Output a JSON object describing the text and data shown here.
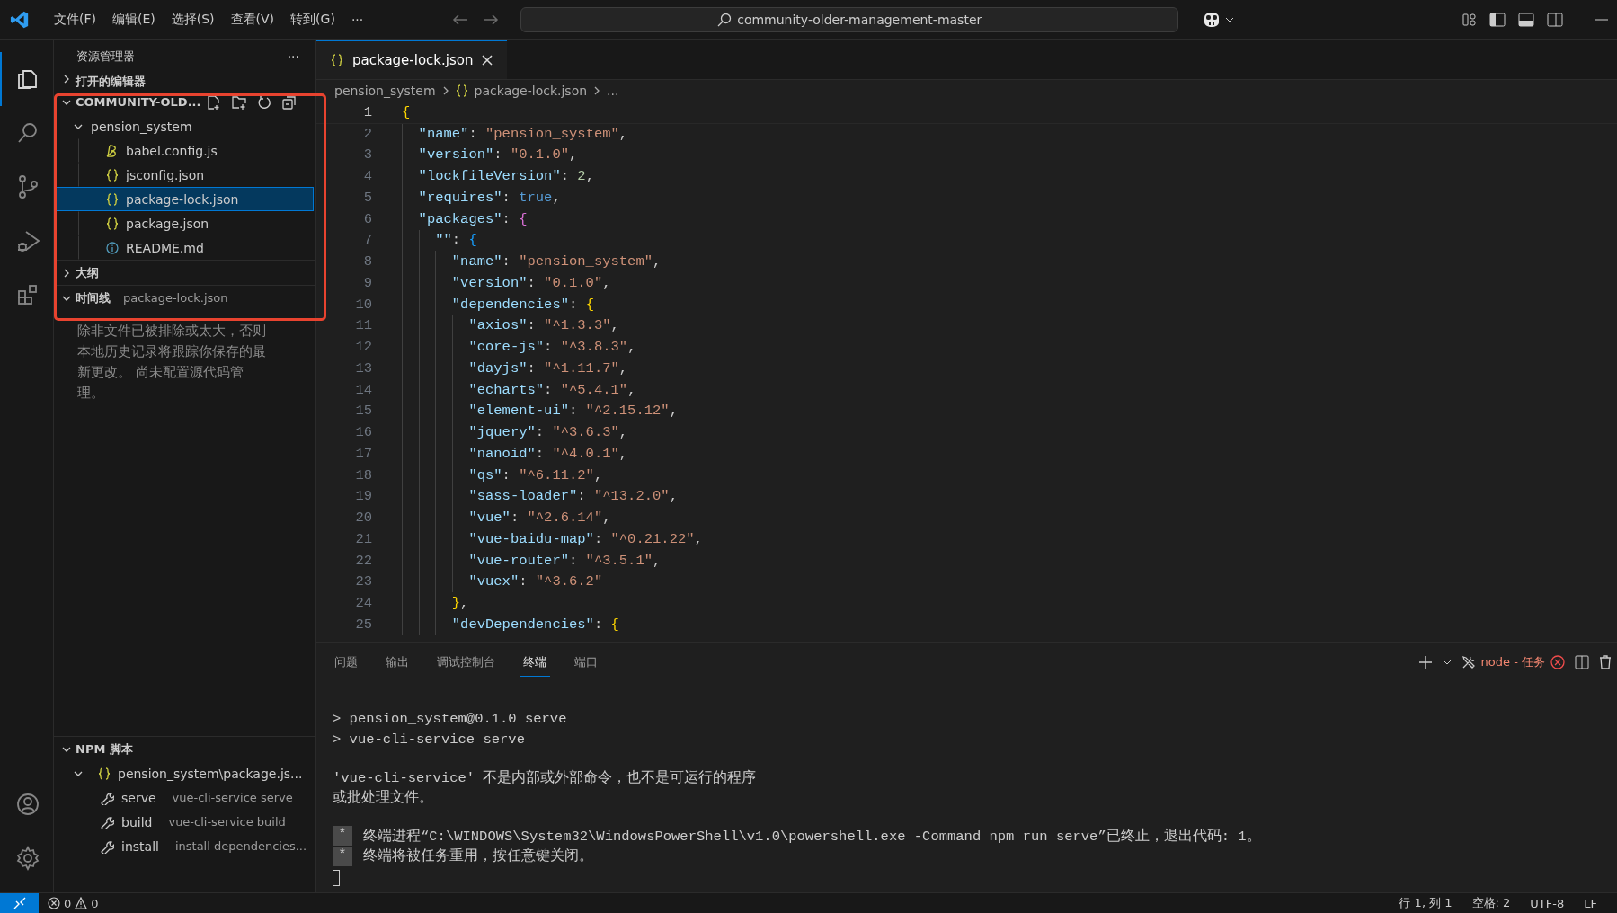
{
  "title_bar": {
    "menus": [
      "文件(F)",
      "编辑(E)",
      "选择(S)",
      "查看(V)",
      "转到(G)",
      "···"
    ],
    "search": "community-older-management-master"
  },
  "activity_bar": [
    {
      "kind": "explorer",
      "selected": true
    },
    {
      "kind": "search",
      "selected": false
    },
    {
      "kind": "source-control",
      "selected": false
    },
    {
      "kind": "run-debug",
      "selected": false
    },
    {
      "kind": "extensions",
      "selected": false
    },
    {
      "kind": "account",
      "selected": false
    },
    {
      "kind": "settings",
      "selected": false
    }
  ],
  "sidebar": {
    "title": "资源管理器",
    "more": "···",
    "open_editors": {
      "label": "打开的编辑器",
      "expanded": false
    },
    "folder": {
      "label": "COMMUNITY-OLD...",
      "expanded": true,
      "children": [
        {
          "label": "pension_system",
          "expanded": true,
          "children": [
            {
              "label": "babel.config.js",
              "kind": "babel",
              "selected": false
            },
            {
              "label": "jsconfig.json",
              "kind": "json",
              "selected": false
            },
            {
              "label": "package-lock.json",
              "kind": "json",
              "selected": true
            },
            {
              "label": "package.json",
              "kind": "json",
              "selected": false
            },
            {
              "label": "README.md",
              "kind": "info",
              "selected": false
            }
          ]
        }
      ]
    },
    "outline": {
      "label": "大纲",
      "expanded": false
    },
    "timeline": {
      "label": "时间线",
      "description": "package-lock.json",
      "expanded": true,
      "message": "除非文件已被排除或太大，否则本地历史记录将跟踪你保存的最新更改。 尚未配置源代码管理。"
    },
    "npm": {
      "label": "NPM 脚本",
      "expanded": true,
      "children": [
        {
          "label": "pension_system\\package.js...",
          "expanded": true,
          "children": [
            {
              "label": "serve",
              "description": "vue-cli-service serve"
            },
            {
              "label": "build",
              "description": "vue-cli-service build"
            },
            {
              "label": "install",
              "description": "install dependencies..."
            }
          ]
        }
      ]
    }
  },
  "tabs": [
    {
      "label": "package-lock.json",
      "selected": true
    }
  ],
  "breadcrumb": [
    "pension_system",
    "package-lock.json",
    "..."
  ],
  "editor": {
    "lines": [
      {
        "number": "1",
        "tokens": [
          {
            "kind": "brace1",
            "text": "{"
          }
        ]
      },
      {
        "number": "2",
        "tokens": [
          {
            "kind": "key",
            "text": "  \"name\""
          },
          {
            "kind": "punct",
            "text": ": "
          },
          {
            "kind": "string",
            "text": "\"pension_system\""
          },
          {
            "kind": "punct",
            "text": ","
          }
        ]
      },
      {
        "number": "3",
        "tokens": [
          {
            "kind": "key",
            "text": "  \"version\""
          },
          {
            "kind": "punct",
            "text": ": "
          },
          {
            "kind": "string",
            "text": "\"0.1.0\""
          },
          {
            "kind": "punct",
            "text": ","
          }
        ]
      },
      {
        "number": "4",
        "tokens": [
          {
            "kind": "key",
            "text": "  \"lockfileVersion\""
          },
          {
            "kind": "punct",
            "text": ": "
          },
          {
            "kind": "number",
            "text": "2"
          },
          {
            "kind": "punct",
            "text": ","
          }
        ]
      },
      {
        "number": "5",
        "tokens": [
          {
            "kind": "key",
            "text": "  \"requires\""
          },
          {
            "kind": "punct",
            "text": ": "
          },
          {
            "kind": "bool",
            "text": "true"
          },
          {
            "kind": "punct",
            "text": ","
          }
        ]
      },
      {
        "number": "6",
        "tokens": [
          {
            "kind": "key",
            "text": "  \"packages\""
          },
          {
            "kind": "punct",
            "text": ": "
          },
          {
            "kind": "brace2",
            "text": "{"
          }
        ]
      },
      {
        "number": "7",
        "tokens": [
          {
            "kind": "key",
            "text": "    \"\""
          },
          {
            "kind": "punct",
            "text": ": "
          },
          {
            "kind": "brace3",
            "text": "{"
          }
        ]
      },
      {
        "number": "8",
        "tokens": [
          {
            "kind": "key",
            "text": "      \"name\""
          },
          {
            "kind": "punct",
            "text": ": "
          },
          {
            "kind": "string",
            "text": "\"pension_system\""
          },
          {
            "kind": "punct",
            "text": ","
          }
        ]
      },
      {
        "number": "9",
        "tokens": [
          {
            "kind": "key",
            "text": "      \"version\""
          },
          {
            "kind": "punct",
            "text": ": "
          },
          {
            "kind": "string",
            "text": "\"0.1.0\""
          },
          {
            "kind": "punct",
            "text": ","
          }
        ]
      },
      {
        "number": "10",
        "tokens": [
          {
            "kind": "key",
            "text": "      \"dependencies\""
          },
          {
            "kind": "punct",
            "text": ": "
          },
          {
            "kind": "brace1",
            "text": "{"
          }
        ]
      },
      {
        "number": "11",
        "tokens": [
          {
            "kind": "key",
            "text": "        \"axios\""
          },
          {
            "kind": "punct",
            "text": ": "
          },
          {
            "kind": "string",
            "text": "\"^1.3.3\""
          },
          {
            "kind": "punct",
            "text": ","
          }
        ]
      },
      {
        "number": "12",
        "tokens": [
          {
            "kind": "key",
            "text": "        \"core-js\""
          },
          {
            "kind": "punct",
            "text": ": "
          },
          {
            "kind": "string",
            "text": "\"^3.8.3\""
          },
          {
            "kind": "punct",
            "text": ","
          }
        ]
      },
      {
        "number": "13",
        "tokens": [
          {
            "kind": "key",
            "text": "        \"dayjs\""
          },
          {
            "kind": "punct",
            "text": ": "
          },
          {
            "kind": "string",
            "text": "\"^1.11.7\""
          },
          {
            "kind": "punct",
            "text": ","
          }
        ]
      },
      {
        "number": "14",
        "tokens": [
          {
            "kind": "key",
            "text": "        \"echarts\""
          },
          {
            "kind": "punct",
            "text": ": "
          },
          {
            "kind": "string",
            "text": "\"^5.4.1\""
          },
          {
            "kind": "punct",
            "text": ","
          }
        ]
      },
      {
        "number": "15",
        "tokens": [
          {
            "kind": "key",
            "text": "        \"element-ui\""
          },
          {
            "kind": "punct",
            "text": ": "
          },
          {
            "kind": "string",
            "text": "\"^2.15.12\""
          },
          {
            "kind": "punct",
            "text": ","
          }
        ]
      },
      {
        "number": "16",
        "tokens": [
          {
            "kind": "key",
            "text": "        \"jquery\""
          },
          {
            "kind": "punct",
            "text": ": "
          },
          {
            "kind": "string",
            "text": "\"^3.6.3\""
          },
          {
            "kind": "punct",
            "text": ","
          }
        ]
      },
      {
        "number": "17",
        "tokens": [
          {
            "kind": "key",
            "text": "        \"nanoid\""
          },
          {
            "kind": "punct",
            "text": ": "
          },
          {
            "kind": "string",
            "text": "\"^4.0.1\""
          },
          {
            "kind": "punct",
            "text": ","
          }
        ]
      },
      {
        "number": "18",
        "tokens": [
          {
            "kind": "key",
            "text": "        \"qs\""
          },
          {
            "kind": "punct",
            "text": ": "
          },
          {
            "kind": "string",
            "text": "\"^6.11.2\""
          },
          {
            "kind": "punct",
            "text": ","
          }
        ]
      },
      {
        "number": "19",
        "tokens": [
          {
            "kind": "key",
            "text": "        \"sass-loader\""
          },
          {
            "kind": "punct",
            "text": ": "
          },
          {
            "kind": "string",
            "text": "\"^13.2.0\""
          },
          {
            "kind": "punct",
            "text": ","
          }
        ]
      },
      {
        "number": "20",
        "tokens": [
          {
            "kind": "key",
            "text": "        \"vue\""
          },
          {
            "kind": "punct",
            "text": ": "
          },
          {
            "kind": "string",
            "text": "\"^2.6.14\""
          },
          {
            "kind": "punct",
            "text": ","
          }
        ]
      },
      {
        "number": "21",
        "tokens": [
          {
            "kind": "key",
            "text": "        \"vue-baidu-map\""
          },
          {
            "kind": "punct",
            "text": ": "
          },
          {
            "kind": "string",
            "text": "\"^0.21.22\""
          },
          {
            "kind": "punct",
            "text": ","
          }
        ]
      },
      {
        "number": "22",
        "tokens": [
          {
            "kind": "key",
            "text": "        \"vue-router\""
          },
          {
            "kind": "punct",
            "text": ": "
          },
          {
            "kind": "string",
            "text": "\"^3.5.1\""
          },
          {
            "kind": "punct",
            "text": ","
          }
        ]
      },
      {
        "number": "23",
        "tokens": [
          {
            "kind": "key",
            "text": "        \"vuex\""
          },
          {
            "kind": "punct",
            "text": ": "
          },
          {
            "kind": "string",
            "text": "\"^3.6.2\""
          }
        ]
      },
      {
        "number": "24",
        "tokens": [
          {
            "kind": "brace1",
            "text": "      }"
          },
          {
            "kind": "punct",
            "text": ","
          }
        ]
      },
      {
        "number": "25",
        "tokens": [
          {
            "kind": "key",
            "text": "      \"devDependencies\""
          },
          {
            "kind": "punct",
            "text": ": "
          },
          {
            "kind": "brace1",
            "text": "{"
          }
        ]
      }
    ]
  },
  "panel": {
    "tabs": [
      {
        "label": "问题",
        "selected": false
      },
      {
        "label": "输出",
        "selected": false
      },
      {
        "label": "调试控制台",
        "selected": false
      },
      {
        "label": "终端",
        "selected": true
      },
      {
        "label": "端口",
        "selected": false
      }
    ],
    "task": "node - 任务",
    "terminal": [
      {
        "kind": "output",
        "lines": [
          "> pension_system@0.1.0 serve",
          "> vue-cli-service serve"
        ]
      },
      {
        "kind": "output",
        "lines": [
          "'vue-cli-service' 不是内部或外部命令，也不是可运行的程序",
          "或批处理文件。"
        ]
      },
      {
        "kind": "task",
        "marker": "*",
        "lines": [
          "终端进程“C:\\WINDOWS\\System32\\WindowsPowerShell\\v1.0\\powershell.exe -Command npm run serve”已终止，退出代码: 1。",
          "终端将被任务重用，按任意键关闭。"
        ]
      }
    ]
  },
  "status_bar": {
    "errors": "0",
    "warnings": "0",
    "items": [
      "行 1, 列 1",
      "空格: 2",
      "UTF-8",
      "LF"
    ]
  }
}
